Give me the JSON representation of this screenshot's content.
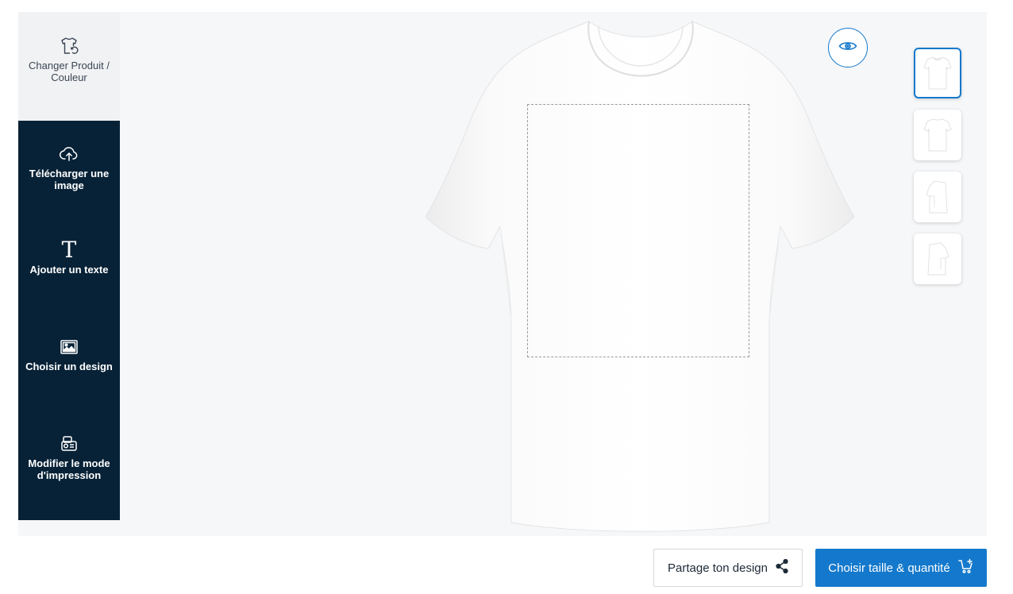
{
  "sidebar": {
    "items": [
      {
        "label": "Changer Produit / Couleur",
        "icon": "tshirt-swap-icon"
      },
      {
        "label": "Télécharger une image",
        "icon": "cloud-upload-icon"
      },
      {
        "label": "Ajouter un texte",
        "icon": "text-icon"
      },
      {
        "label": "Choisir un design",
        "icon": "image-gallery-icon"
      },
      {
        "label": "Modifier le mode d'impression",
        "icon": "printer-icon"
      }
    ]
  },
  "canvas": {
    "product": "white-tshirt",
    "preview_icon": "eye-icon",
    "views": [
      {
        "name": "front",
        "active": true
      },
      {
        "name": "back",
        "active": false
      },
      {
        "name": "left-sleeve",
        "active": false
      },
      {
        "name": "right-sleeve",
        "active": false
      }
    ]
  },
  "actions": {
    "share_label": "Partage ton design",
    "share_icon": "share-icon",
    "cart_label": "Choisir taille & quantité",
    "cart_icon": "cart-icon"
  },
  "colors": {
    "primary": "#1479cc",
    "sidebar_dark": "#072237",
    "canvas_bg": "#f6f7f9"
  }
}
